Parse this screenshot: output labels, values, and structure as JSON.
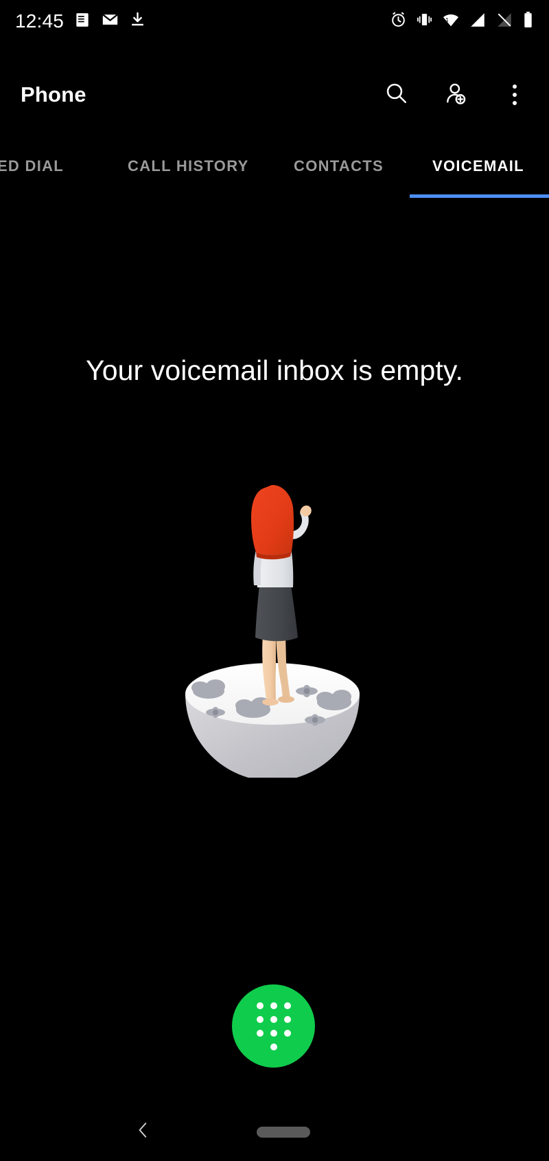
{
  "status_bar": {
    "clock": "12:45",
    "left_icons": [
      "article-icon",
      "email-icon",
      "download-icon"
    ],
    "right_icons": [
      "alarm-icon",
      "vibrate-icon",
      "wifi-icon",
      "signal-icon",
      "signal-off-icon",
      "battery-icon"
    ]
  },
  "app_bar": {
    "title": "Phone",
    "actions": [
      {
        "icon": "search-icon",
        "label": "Search"
      },
      {
        "icon": "add-contact-icon",
        "label": "Add contact"
      },
      {
        "icon": "overflow-menu-icon",
        "label": "More options"
      }
    ]
  },
  "tabs": {
    "items": [
      {
        "label": "PEED DIAL",
        "active": false
      },
      {
        "label": "CALL HISTORY",
        "active": false
      },
      {
        "label": "CONTACTS",
        "active": false
      },
      {
        "label": "VOICEMAIL",
        "active": true
      }
    ],
    "indicator_color": "#4d8ef7",
    "active_text_color": "#ffffff",
    "inactive_text_color": "#9a9a9a"
  },
  "main": {
    "empty_state": {
      "message": "Your voicemail inbox is empty.",
      "illustration": "woman-on-globe-illustration"
    }
  },
  "fab": {
    "icon": "dialpad-icon",
    "label": "Open dialpad",
    "color": "#10cc4c"
  },
  "nav_bar": {
    "back": "back-chevron-icon",
    "home": "home-pill-icon"
  },
  "colors": {
    "background": "#000000",
    "accent_blue": "#4d8ef7",
    "accent_green": "#10cc4c",
    "text_primary": "#ffffff",
    "text_secondary": "#9a9a9a"
  }
}
